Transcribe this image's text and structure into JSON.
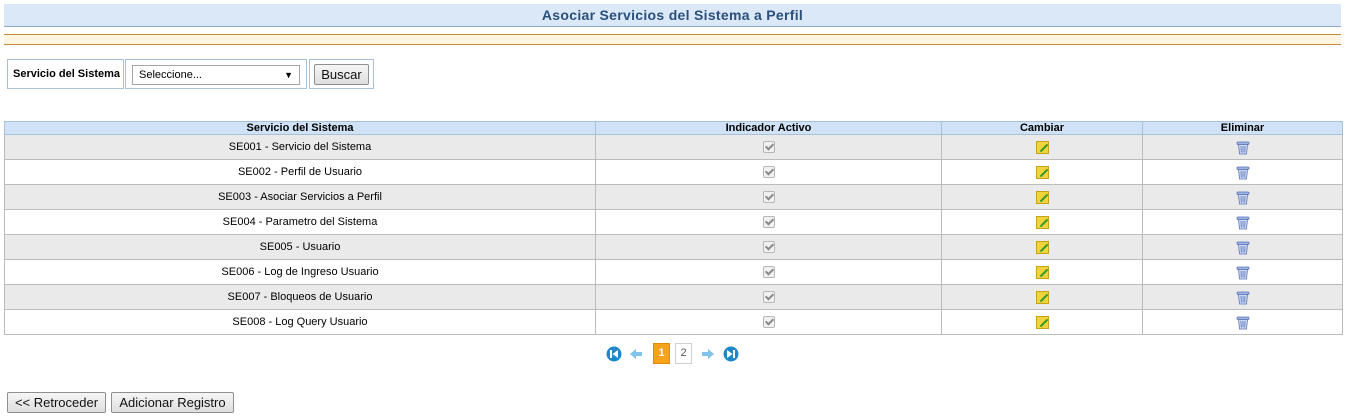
{
  "page": {
    "title": "Asociar Servicios del Sistema a Perfil"
  },
  "filter": {
    "label": "Servicio del Sistema",
    "select_value": "Seleccione...",
    "search_button": "Buscar"
  },
  "table": {
    "columns": [
      "Servicio del Sistema",
      "Indicador Activo",
      "Cambiar",
      "Eliminar"
    ],
    "rows": [
      {
        "service": "SE001 - Servicio del Sistema",
        "active": true
      },
      {
        "service": "SE002 - Perfil de Usuario",
        "active": true
      },
      {
        "service": "SE003 - Asociar Servicios a Perfil",
        "active": true
      },
      {
        "service": "SE004 - Parametro del Sistema",
        "active": true
      },
      {
        "service": "SE005 - Usuario",
        "active": true
      },
      {
        "service": "SE006 - Log de Ingreso Usuario",
        "active": true
      },
      {
        "service": "SE007 - Bloqueos de Usuario",
        "active": true
      },
      {
        "service": "SE008 - Log Query Usuario",
        "active": true
      }
    ]
  },
  "pagination": {
    "pages": [
      "1",
      "2"
    ],
    "current": "1",
    "icons": [
      "first-page-icon",
      "prev-page-icon",
      "next-page-icon",
      "last-page-icon"
    ]
  },
  "actions": {
    "back_button": "<< Retroceder",
    "add_button": "Adicionar Registro"
  },
  "colors": {
    "title_text": "#2b4f7c",
    "header_bg": "#cfe2f6",
    "active_page": "#f7a21b",
    "pager_icon": "#1e88c9"
  }
}
